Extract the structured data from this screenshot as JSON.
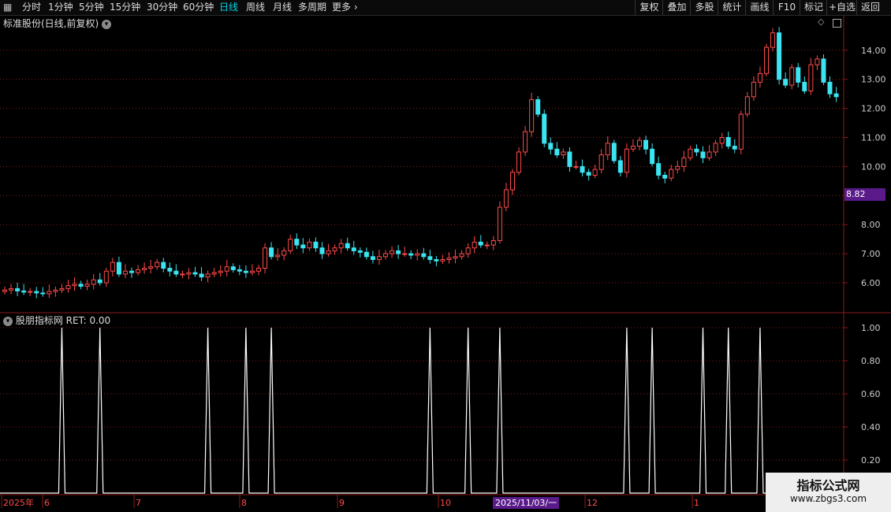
{
  "toolbar": {
    "periods": [
      "分时",
      "1分钟",
      "5分钟",
      "15分钟",
      "30分钟",
      "60分钟",
      "日线",
      "周线",
      "月线",
      "多周期",
      "更多"
    ],
    "active_period": "日线",
    "actions": [
      "复权",
      "叠加",
      "多股",
      "统计",
      "画线",
      "F10",
      "标记",
      "+自选",
      "返回"
    ]
  },
  "main_panel": {
    "title": "标准股份(日线,前复权)",
    "price_axis_ticks": [
      "14.00",
      "13.00",
      "12.00",
      "11.00",
      "10.00",
      "9.00",
      "8.00",
      "7.00",
      "6.00"
    ],
    "current_price_badge": "8.82",
    "candle_close_prices": [
      5.75,
      5.8,
      5.72,
      5.68,
      5.7,
      5.65,
      5.62,
      5.7,
      5.75,
      5.8,
      5.9,
      5.95,
      5.88,
      5.95,
      6.1,
      6.0,
      6.4,
      6.7,
      6.3,
      6.4,
      6.35,
      6.45,
      6.5,
      6.55,
      6.7,
      6.5,
      6.4,
      6.3,
      6.3,
      6.35,
      6.3,
      6.2,
      6.3,
      6.35,
      6.4,
      6.55,
      6.45,
      6.4,
      6.35,
      6.4,
      6.5,
      7.2,
      6.9,
      6.95,
      7.1,
      7.5,
      7.3,
      7.2,
      7.4,
      7.2,
      7.0,
      7.1,
      7.2,
      7.35,
      7.2,
      7.1,
      7.05,
      6.9,
      6.8,
      6.9,
      7.0,
      7.1,
      7.0,
      7.0,
      6.95,
      7.0,
      6.9,
      6.8,
      6.75,
      6.8,
      6.85,
      6.9,
      7.0,
      7.2,
      7.4,
      7.3,
      7.3,
      7.45,
      8.6,
      9.2,
      9.8,
      10.5,
      11.2,
      12.3,
      11.8,
      10.8,
      10.6,
      10.4,
      10.5,
      10.0,
      10.0,
      9.8,
      9.7,
      9.9,
      10.4,
      10.8,
      10.2,
      9.8,
      10.6,
      10.7,
      10.9,
      10.6,
      10.1,
      9.7,
      9.6,
      9.9,
      10.0,
      10.3,
      10.6,
      10.5,
      10.3,
      10.5,
      10.8,
      11.0,
      10.7,
      10.6,
      11.8,
      12.4,
      12.9,
      13.2,
      14.1,
      14.6,
      13.0,
      12.8,
      13.4,
      12.9,
      12.6,
      13.5,
      13.7,
      12.9,
      12.5,
      12.4
    ]
  },
  "indicator_panel": {
    "title": "股朋指标网",
    "ret_label": "RET: 0.00",
    "axis_ticks": [
      "1.00",
      "0.80",
      "0.60",
      "0.40",
      "0.20"
    ],
    "signal_indices": [
      9,
      15,
      32,
      38,
      42,
      67,
      73,
      78,
      98,
      102,
      110,
      114,
      119
    ]
  },
  "time_axis": {
    "labels": [
      "2025年",
      "6",
      "7",
      "8",
      "9",
      "10",
      "12",
      "1"
    ],
    "cursor_date": "2025/11/03/一"
  },
  "watermark": {
    "line1": "指标公式网",
    "line2": "www.zbgs3.com"
  },
  "colors": {
    "up": "#ff4a4a",
    "down": "#3be4f0",
    "grid": "#8b1a1a",
    "signal": "#ffffff",
    "axis_text": "#cccccc",
    "active": "#00d8e8",
    "badge": "#5a1a8a"
  }
}
